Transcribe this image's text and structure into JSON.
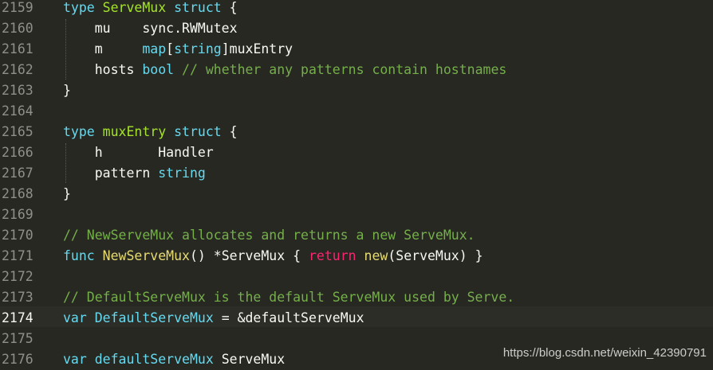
{
  "editor": {
    "active_line": 2174,
    "lines": [
      {
        "num": "2159",
        "tokens": [
          {
            "t": "type ",
            "c": "kw"
          },
          {
            "t": "ServeMux",
            "c": "name"
          },
          {
            "t": " struct ",
            "c": "kw"
          },
          {
            "t": "{",
            "c": "plain"
          }
        ]
      },
      {
        "num": "2160",
        "tokens": [
          {
            "t": "    mu    sync.RWMutex",
            "c": "plain"
          }
        ]
      },
      {
        "num": "2161",
        "tokens": [
          {
            "t": "    m     ",
            "c": "plain"
          },
          {
            "t": "map",
            "c": "builtin"
          },
          {
            "t": "[",
            "c": "plain"
          },
          {
            "t": "string",
            "c": "builtin"
          },
          {
            "t": "]muxEntry",
            "c": "plain"
          }
        ]
      },
      {
        "num": "2162",
        "tokens": [
          {
            "t": "    hosts ",
            "c": "plain"
          },
          {
            "t": "bool",
            "c": "builtin"
          },
          {
            "t": " // whether any patterns contain hostnames",
            "c": "comment"
          }
        ]
      },
      {
        "num": "2163",
        "tokens": [
          {
            "t": "}",
            "c": "plain"
          }
        ]
      },
      {
        "num": "2164",
        "tokens": []
      },
      {
        "num": "2165",
        "tokens": [
          {
            "t": "type ",
            "c": "kw"
          },
          {
            "t": "muxEntry",
            "c": "name"
          },
          {
            "t": " struct ",
            "c": "kw"
          },
          {
            "t": "{",
            "c": "plain"
          }
        ]
      },
      {
        "num": "2166",
        "tokens": [
          {
            "t": "    h       Handler",
            "c": "plain"
          }
        ]
      },
      {
        "num": "2167",
        "tokens": [
          {
            "t": "    pattern ",
            "c": "plain"
          },
          {
            "t": "string",
            "c": "builtin"
          }
        ]
      },
      {
        "num": "2168",
        "tokens": [
          {
            "t": "}",
            "c": "plain"
          }
        ]
      },
      {
        "num": "2169",
        "tokens": []
      },
      {
        "num": "2170",
        "tokens": [
          {
            "t": "// NewServeMux allocates and returns a new ServeMux.",
            "c": "comment"
          }
        ]
      },
      {
        "num": "2171",
        "tokens": [
          {
            "t": "func ",
            "c": "kw"
          },
          {
            "t": "NewServeMux",
            "c": "fn"
          },
          {
            "t": "() *ServeMux { ",
            "c": "plain"
          },
          {
            "t": "return",
            "c": "ctrl"
          },
          {
            "t": " ",
            "c": "plain"
          },
          {
            "t": "new",
            "c": "fn"
          },
          {
            "t": "(ServeMux) }",
            "c": "plain"
          }
        ]
      },
      {
        "num": "2172",
        "tokens": []
      },
      {
        "num": "2173",
        "tokens": [
          {
            "t": "// DefaultServeMux is the default ServeMux used by Serve.",
            "c": "comment"
          }
        ]
      },
      {
        "num": "2174",
        "tokens": [
          {
            "t": "var ",
            "c": "kw"
          },
          {
            "t": "DefaultServeMux",
            "c": "var"
          },
          {
            "t": " = &defaultServeMux",
            "c": "plain"
          }
        ]
      },
      {
        "num": "2175",
        "tokens": []
      },
      {
        "num": "2176",
        "tokens": [
          {
            "t": "var ",
            "c": "kw"
          },
          {
            "t": "defaultServeMux",
            "c": "var"
          },
          {
            "t": " ServeMux",
            "c": "plain"
          }
        ]
      }
    ]
  },
  "watermark": "https://blog.csdn.net/weixin_42390791",
  "colors": {
    "background": "#272822",
    "keyword": "#66d9ef",
    "type_name": "#a6e22e",
    "comment": "#75af4a",
    "control": "#f92672",
    "function": "#e6db74",
    "plain": "#f8f8f2",
    "gutter": "#8f908a"
  }
}
